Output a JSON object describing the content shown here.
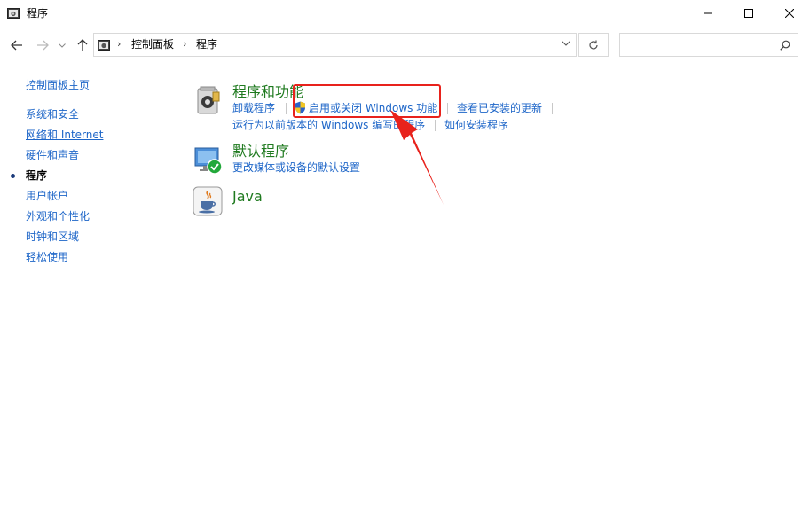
{
  "window": {
    "title": "程序",
    "icon": "control-panel-icon",
    "controls": [
      "minimize-icon",
      "maximize-icon",
      "close-icon"
    ]
  },
  "address_bar": {
    "crumbs": [
      "控制面板",
      "程序"
    ],
    "search_placeholder": ""
  },
  "sidebar": {
    "home": "控制面板主页",
    "items": [
      {
        "label": "系统和安全"
      },
      {
        "label": "网络和 Internet"
      },
      {
        "label": "硬件和声音"
      },
      {
        "label": "程序"
      },
      {
        "label": "用户帐户"
      },
      {
        "label": "外观和个性化"
      },
      {
        "label": "时钟和区域"
      },
      {
        "label": "轻松使用"
      }
    ]
  },
  "sections": [
    {
      "title": "程序和功能",
      "icon": "programs-and-features-icon",
      "tasks": [
        "卸载程序",
        "启用或关闭 Windows 功能",
        "查看已安装的更新",
        "运行为以前版本的 Windows 编写的程序",
        "如何安装程序"
      ]
    },
    {
      "title": "默认程序",
      "icon": "default-programs-icon",
      "tasks": [
        "更改媒体或设备的默认设置"
      ]
    },
    {
      "title": "Java",
      "icon": "java-icon",
      "tasks": []
    }
  ],
  "annotation": {
    "highlight_color": "#e8221c",
    "target": "启用或关闭 Windows 功能"
  },
  "colors": {
    "link": "#1e66c8",
    "section_title": "#1f7a1f"
  }
}
